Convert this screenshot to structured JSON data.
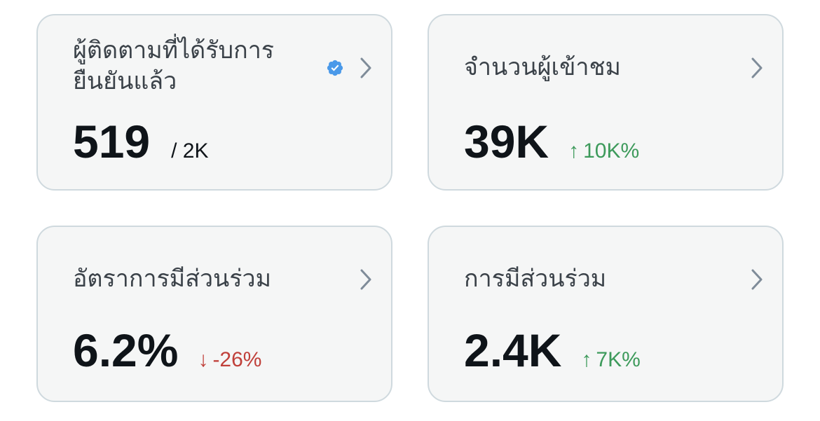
{
  "cards": [
    {
      "title": "ผู้ติดตามที่ได้รับการยืนยันแล้ว",
      "value": "519",
      "total": "/ 2K",
      "verified_icon": "verified-badge-icon",
      "verified_color": "#1d9bf0"
    },
    {
      "title": "จำนวนผู้เข้าชม",
      "value": "39K",
      "delta_arrow": "↑",
      "delta": "10K%",
      "delta_color": "#3d9a5b"
    },
    {
      "title": "อัตราการมีส่วนร่วม",
      "value": "6.2%",
      "delta_arrow": "↓",
      "delta": "-26%",
      "delta_color": "#c0403a"
    },
    {
      "title": "การมีส่วนร่วม",
      "value": "2.4K",
      "delta_arrow": "↑",
      "delta": "7K%",
      "delta_color": "#3d9a5b"
    }
  ],
  "icons": {
    "chevron": "chevron-right-icon"
  }
}
